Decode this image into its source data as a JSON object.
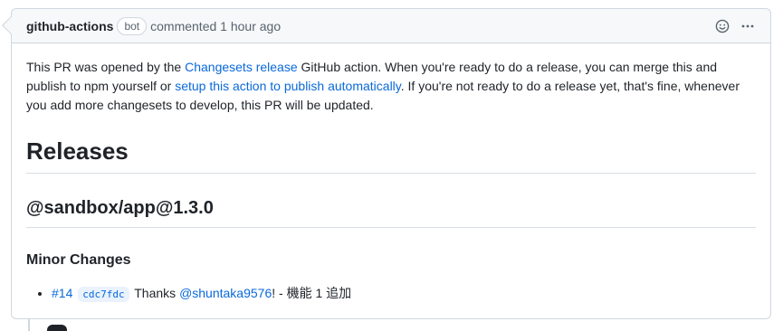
{
  "comment": {
    "author": "github-actions",
    "bot_label": "bot",
    "timestamp": "commented 1 hour ago",
    "intro": {
      "part1": "This PR was opened by the ",
      "link1": "Changesets release",
      "part2": " GitHub action. When you're ready to do a release, you can merge this and publish to npm yourself or ",
      "link2": "setup this action to publish automatically",
      "part3": ". If you're not ready to do a release yet, that's fine, whenever you add more changesets to develop, this PR will be updated."
    },
    "releases_heading": "Releases",
    "package_heading": "@sandbox/app@1.3.0",
    "minor_heading": "Minor Changes",
    "changes": [
      {
        "pr_link": "#14",
        "commit": "cdc7fdc",
        "thanks": "Thanks",
        "user": "@shuntaka9576",
        "text": "! - 機能 1 追加"
      }
    ]
  },
  "icons": {
    "reaction": "smiley-icon",
    "menu": "kebab-horizontal-icon"
  },
  "colors": {
    "link": "#0969da",
    "border": "#d0d7de",
    "header_bg": "#f6f8fa",
    "text": "#1f2328",
    "muted": "#59636e"
  }
}
